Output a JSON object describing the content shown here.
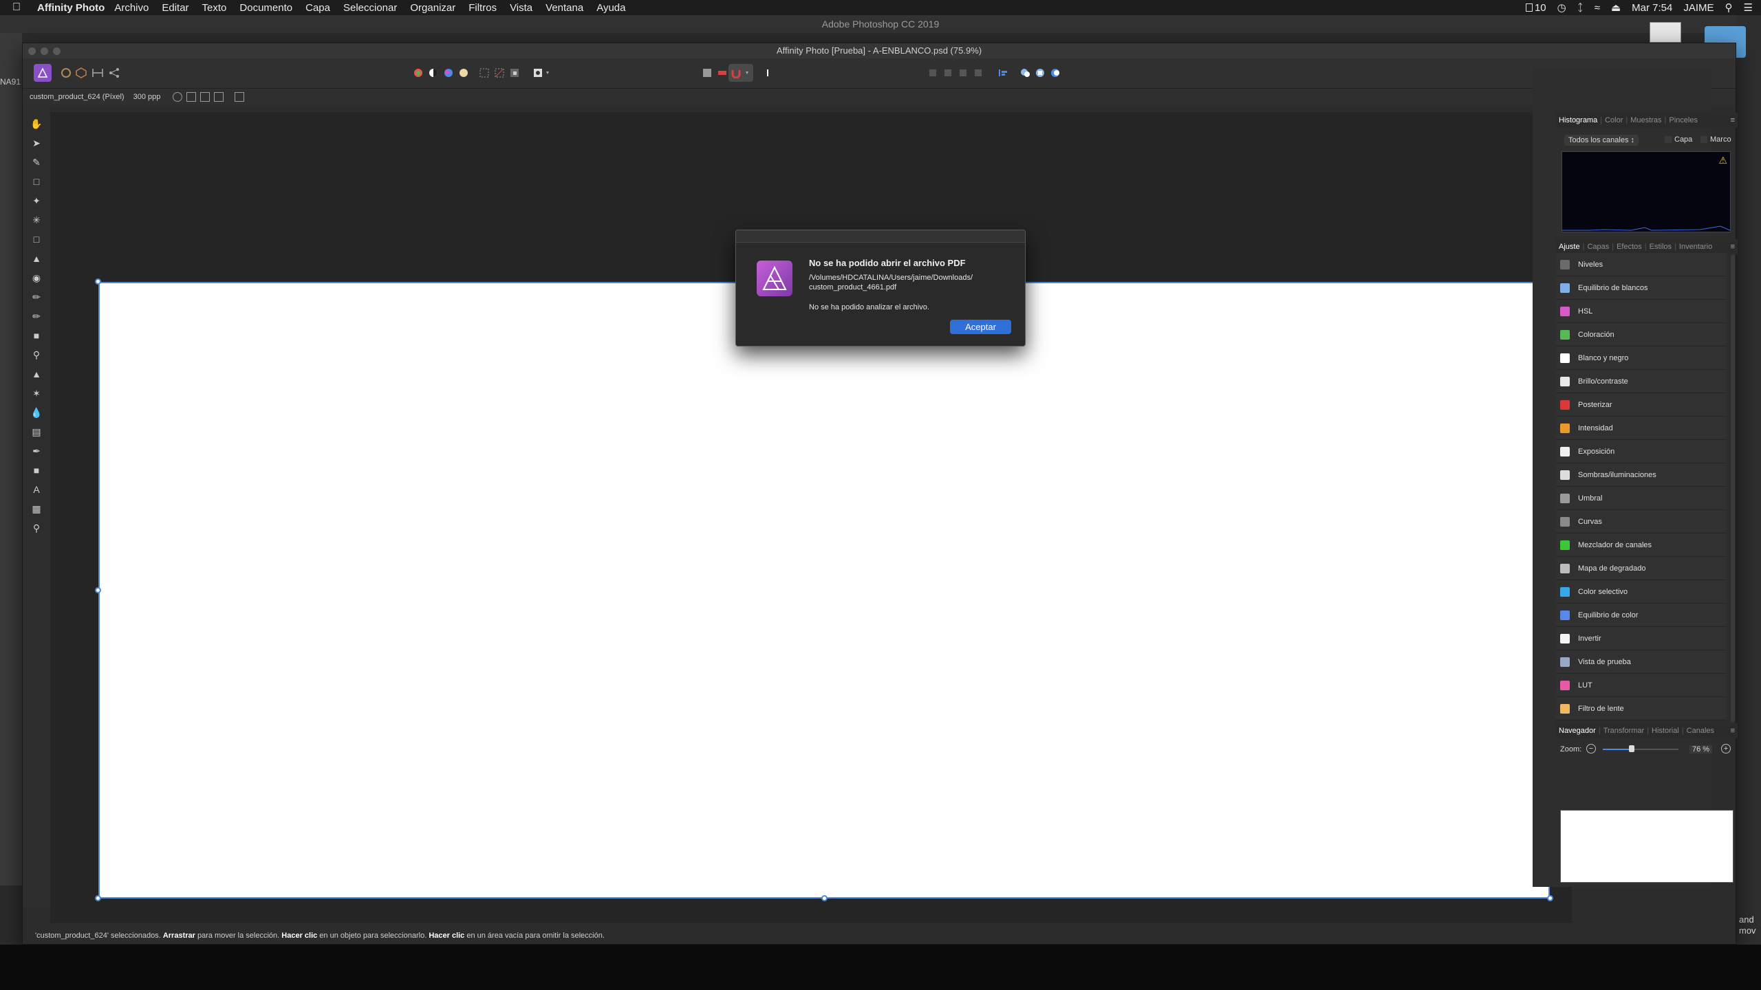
{
  "menubar": {
    "app_name": "Affinity Photo",
    "items": [
      "Archivo",
      "Editar",
      "Texto",
      "Documento",
      "Capa",
      "Seleccionar",
      "Organizar",
      "Filtros",
      "Vista",
      "Ventana",
      "Ayuda"
    ],
    "battery": "10",
    "clock": "Mar 7:54",
    "user": "JAIME"
  },
  "background_app": {
    "title": "Adobe Photoshop CC 2019",
    "left_text": "NA91",
    "right_text": [
      "and",
      "mov"
    ]
  },
  "window": {
    "title": "Affinity Photo [Prueba] - A-ENBLANCO.psd (75.9%)"
  },
  "context_bar": {
    "layer": "custom_product_624 (Píxel)",
    "dpi": "300 ppp"
  },
  "dialog": {
    "title": "No se ha podido abrir el archivo PDF",
    "path_line1": "/Volumes/HDCATALINA/Users/jaime/Downloads/",
    "path_line2": "custom_product_4661.pdf",
    "message": "No se ha podido analizar el archivo.",
    "ok_label": "Aceptar"
  },
  "panel_top": {
    "tabs": [
      "Histograma",
      "Color",
      "Muestras",
      "Pinceles"
    ],
    "channels": "Todos los canales",
    "capa": "Capa",
    "marco": "Marco"
  },
  "panel_mid": {
    "tabs": [
      "Ajuste",
      "Capas",
      "Efectos",
      "Estilos",
      "Inventario"
    ],
    "adjustments": [
      {
        "label": "Niveles",
        "color": "#6b6b6b"
      },
      {
        "label": "Equilibrio de blancos",
        "color": "#7bb0e8"
      },
      {
        "label": "HSL",
        "color": "#d85ac8"
      },
      {
        "label": "Coloración",
        "color": "#58b858"
      },
      {
        "label": "Blanco y negro",
        "color": "#ffffff"
      },
      {
        "label": "Brillo/contraste",
        "color": "#e8e8e8"
      },
      {
        "label": "Posterizar",
        "color": "#d83a3a"
      },
      {
        "label": "Intensidad",
        "color": "#e89a2a"
      },
      {
        "label": "Exposición",
        "color": "#f0f0f0"
      },
      {
        "label": "Sombras/iluminaciones",
        "color": "#dcdcdc"
      },
      {
        "label": "Umbral",
        "color": "#9a9a9a"
      },
      {
        "label": "Curvas",
        "color": "#8a8a8a"
      },
      {
        "label": "Mezclador de canales",
        "color": "#3ac838"
      },
      {
        "label": "Mapa de degradado",
        "color": "#bdbdbd"
      },
      {
        "label": "Color selectivo",
        "color": "#38a8e8"
      },
      {
        "label": "Equilibrio de color",
        "color": "#5888e8"
      },
      {
        "label": "Invertir",
        "color": "#f4f4f4"
      },
      {
        "label": "Vista de prueba",
        "color": "#9aa8c8"
      },
      {
        "label": "LUT",
        "color": "#e85aa8"
      },
      {
        "label": "Filtro de lente",
        "color": "#f0b860"
      }
    ]
  },
  "panel_bottom": {
    "tabs": [
      "Navegador",
      "Transformar",
      "Historial",
      "Canales"
    ],
    "zoom_label": "Zoom:",
    "zoom_value": "76 %"
  },
  "status": {
    "part1": "'custom_product_624' seleccionados. ",
    "bold1": "Arrastrar",
    "part2": " para mover la selección. ",
    "bold2": "Hacer clic",
    "part3": " en un objeto para seleccionarlo. ",
    "bold3": "Hacer clic",
    "part4": " en un área vacía para omitir la selección."
  }
}
